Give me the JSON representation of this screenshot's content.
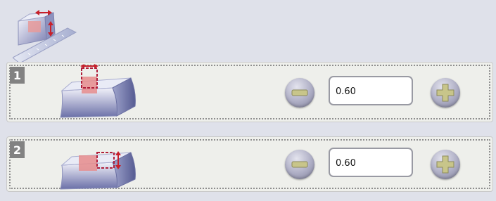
{
  "header": {
    "icon": "edge-offset-adjust-icon"
  },
  "rows": [
    {
      "number": "1",
      "value": "0.60",
      "icon": "top-edge-gap-icon",
      "decrease_icon": "minus-icon",
      "increase_icon": "plus-icon"
    },
    {
      "number": "2",
      "value": "0.60",
      "icon": "side-edge-gap-icon",
      "decrease_icon": "minus-icon",
      "increase_icon": "plus-icon"
    }
  ],
  "colors": {
    "panel": "#eeefeb",
    "background": "#dfe1ea",
    "badge": "#828282",
    "indicator": "#c8202a"
  }
}
